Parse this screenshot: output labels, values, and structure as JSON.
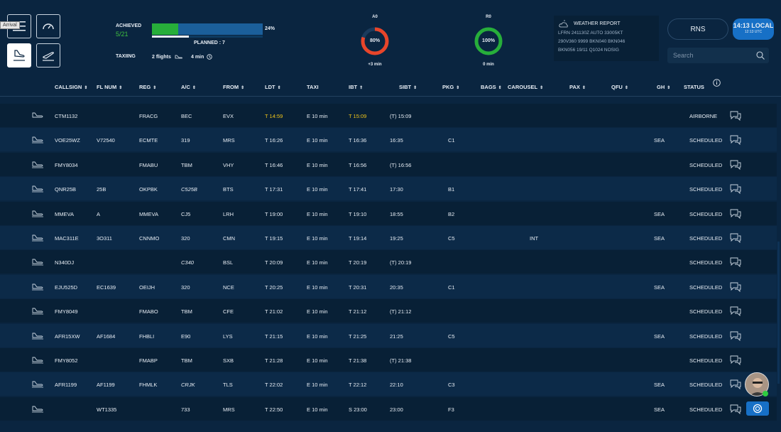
{
  "toolbar": {
    "arrival_tooltip": "Arrival"
  },
  "progress": {
    "achieved_label": "ACHIEVED",
    "achieved_value": "5/21",
    "achieved_fraction": 0.238,
    "planned_fraction": 0.333,
    "percent": "24%",
    "planned_label": "PLANNED : 7",
    "taxiing_label": "TAXIING",
    "taxiing_flights": "2 flights",
    "taxiing_time": "4 min"
  },
  "donuts": [
    {
      "title": "A0",
      "value": "80%",
      "sub": "+3 min",
      "color": "#e8452a",
      "fraction": 0.8
    },
    {
      "title": "R0",
      "value": "100%",
      "sub": "0 min",
      "color": "#27ae3a",
      "fraction": 1.0
    }
  ],
  "weather": {
    "title": "WEATHER REPORT",
    "lines": [
      "LFRN 241130Z AUTO 33005KT",
      "290V360 9999 BKN040 BKN046",
      "BKN056 19/11 Q1024 NOSIG"
    ]
  },
  "rns_label": "RNS",
  "clock": {
    "local": "14:13 LOCAL",
    "utc": "12:13 UTC"
  },
  "search": {
    "placeholder": "Search"
  },
  "columns": [
    "CALLSIGN",
    "FL NUM",
    "REG",
    "A/C",
    "FROM",
    "LDT",
    "TAXI",
    "IBT",
    "SIBT",
    "PKG",
    "BAGS",
    "CAROUSEL",
    "PAX",
    "QFU",
    "GH",
    "STATUS"
  ],
  "sort_markers": {
    "CALLSIGN": "⇕",
    "FL NUM": "⇕",
    "REG": "⇕",
    "A/C": "⇕",
    "FROM": "⇕",
    "LDT": "⇕",
    "IBT": "⇑",
    "SIBT": "⇕",
    "PKG": "⇕",
    "BAGS": "⇕",
    "CAROUSEL": "⇕",
    "PAX": "⇕",
    "QFU": "⇕",
    "GH": "⇕"
  },
  "flights": [
    {
      "callsign": "CTM1132",
      "flnum": "",
      "reg": "FRACG",
      "ac": "BEC",
      "ac_italic": false,
      "from": "EVX",
      "ldt": "T 14:59",
      "ldt_yellow": true,
      "taxi": "E 10 min",
      "ibt": "T 15:09",
      "ibt_yellow": true,
      "sibt": "(T) 15:09",
      "pkg": "",
      "bags": "",
      "carousel": "",
      "pax": "",
      "qfu": "",
      "gh": "",
      "status": "AIRBORNE",
      "taxiing": true
    },
    {
      "callsign": "VOE25WZ",
      "flnum": "V72540",
      "reg": "ECMTE",
      "ac": "319",
      "ac_italic": false,
      "from": "MRS",
      "ldt": "T 16:26",
      "ldt_yellow": false,
      "taxi": "E 10 min",
      "ibt": "T 16:36",
      "ibt_yellow": false,
      "sibt": "16:35",
      "pkg": "C1",
      "bags": "",
      "carousel": "",
      "pax": "",
      "qfu": "",
      "gh": "SEA",
      "status": "SCHEDULED",
      "taxiing": false
    },
    {
      "callsign": "FMY8034",
      "flnum": "",
      "reg": "FMABU",
      "ac": "TBM",
      "ac_italic": false,
      "from": "VHY",
      "ldt": "T 16:46",
      "ldt_yellow": false,
      "taxi": "E 10 min",
      "ibt": "T 16:56",
      "ibt_yellow": false,
      "sibt": "(T) 16:56",
      "pkg": "",
      "bags": "",
      "carousel": "",
      "pax": "",
      "qfu": "",
      "gh": "",
      "status": "SCHEDULED",
      "taxiing": false
    },
    {
      "callsign": "QNR25B",
      "flnum": "25B",
      "reg": "OKPBK",
      "ac": "C525B",
      "ac_italic": true,
      "from": "BTS",
      "ldt": "T 17:31",
      "ldt_yellow": false,
      "taxi": "E 10 min",
      "ibt": "T 17:41",
      "ibt_yellow": false,
      "sibt": "17:30",
      "pkg": "B1",
      "bags": "",
      "carousel": "",
      "pax": "",
      "qfu": "",
      "gh": "",
      "status": "SCHEDULED",
      "taxiing": false
    },
    {
      "callsign": "MMEVA",
      "flnum": "A",
      "reg": "MMEVA",
      "ac": "CJ5",
      "ac_italic": false,
      "from": "LRH",
      "ldt": "T 19:00",
      "ldt_yellow": false,
      "taxi": "E 10 min",
      "ibt": "T 19:10",
      "ibt_yellow": false,
      "sibt": "18:55",
      "pkg": "B2",
      "bags": "",
      "carousel": "",
      "pax": "",
      "qfu": "",
      "gh": "SEA",
      "status": "SCHEDULED",
      "taxiing": false
    },
    {
      "callsign": "MAC311E",
      "flnum": "3O311",
      "reg": "CNNMO",
      "ac": "320",
      "ac_italic": false,
      "from": "CMN",
      "ldt": "T 19:15",
      "ldt_yellow": false,
      "taxi": "E 10 min",
      "ibt": "T 19:14",
      "ibt_yellow": false,
      "sibt": "19:25",
      "pkg": "C5",
      "bags": "",
      "carousel": "INT",
      "pax": "",
      "qfu": "",
      "gh": "SEA",
      "status": "SCHEDULED",
      "taxiing": false
    },
    {
      "callsign": "N340DJ",
      "flnum": "",
      "reg": "",
      "ac": "C340",
      "ac_italic": true,
      "from": "BSL",
      "ldt": "T 20:09",
      "ldt_yellow": false,
      "taxi": "E 10 min",
      "ibt": "T 20:19",
      "ibt_yellow": false,
      "sibt": "(T) 20:19",
      "pkg": "",
      "bags": "",
      "carousel": "",
      "pax": "",
      "qfu": "",
      "gh": "",
      "status": "SCHEDULED",
      "taxiing": false
    },
    {
      "callsign": "EJU525D",
      "flnum": "EC1639",
      "reg": "OEIJH",
      "ac": "320",
      "ac_italic": false,
      "from": "NCE",
      "ldt": "T 20:25",
      "ldt_yellow": false,
      "taxi": "E 10 min",
      "ibt": "T 20:31",
      "ibt_yellow": false,
      "sibt": "20:35",
      "pkg": "C1",
      "bags": "",
      "carousel": "",
      "pax": "",
      "qfu": "",
      "gh": "SEA",
      "status": "SCHEDULED",
      "taxiing": false
    },
    {
      "callsign": "FMY8049",
      "flnum": "",
      "reg": "FMABO",
      "ac": "TBM",
      "ac_italic": false,
      "from": "CFE",
      "ldt": "T 21:02",
      "ldt_yellow": false,
      "taxi": "E 10 min",
      "ibt": "T 21:12",
      "ibt_yellow": false,
      "sibt": "(T) 21:12",
      "pkg": "",
      "bags": "",
      "carousel": "",
      "pax": "",
      "qfu": "",
      "gh": "",
      "status": "SCHEDULED",
      "taxiing": false
    },
    {
      "callsign": "AFR15XW",
      "flnum": "AF1684",
      "reg": "FHBLI",
      "ac": "E90",
      "ac_italic": false,
      "from": "LYS",
      "ldt": "T 21:15",
      "ldt_yellow": false,
      "taxi": "E 10 min",
      "ibt": "T 21:25",
      "ibt_yellow": false,
      "sibt": "21:25",
      "pkg": "C5",
      "bags": "",
      "carousel": "",
      "pax": "",
      "qfu": "",
      "gh": "SEA",
      "status": "SCHEDULED",
      "taxiing": false
    },
    {
      "callsign": "FMY8052",
      "flnum": "",
      "reg": "FMABP",
      "ac": "TBM",
      "ac_italic": false,
      "from": "SXB",
      "ldt": "T 21:28",
      "ldt_yellow": false,
      "taxi": "E 10 min",
      "ibt": "T 21:38",
      "ibt_yellow": false,
      "sibt": "(T) 21:38",
      "pkg": "",
      "bags": "",
      "carousel": "",
      "pax": "",
      "qfu": "",
      "gh": "",
      "status": "SCHEDULED",
      "taxiing": false
    },
    {
      "callsign": "AFR1199",
      "flnum": "AF1199",
      "reg": "FHMLK",
      "ac": "CRJK",
      "ac_italic": true,
      "from": "TLS",
      "ldt": "T 22:02",
      "ldt_yellow": false,
      "taxi": "E 10 min",
      "ibt": "T 22:12",
      "ibt_yellow": false,
      "sibt": "22:10",
      "pkg": "C3",
      "bags": "",
      "carousel": "",
      "pax": "",
      "qfu": "",
      "gh": "SEA",
      "status": "SCHEDULED",
      "taxiing": false
    },
    {
      "callsign": "",
      "flnum": "WT1335",
      "reg": "",
      "ac": "733",
      "ac_italic": false,
      "from": "MRS",
      "ldt": "T 22:50",
      "ldt_yellow": false,
      "taxi": "E 10 min",
      "ibt": "S 23:00",
      "ibt_yellow": false,
      "sibt": "23:00",
      "pkg": "F3",
      "bags": "",
      "carousel": "",
      "pax": "",
      "qfu": "",
      "gh": "SEA",
      "status": "SCHEDULED",
      "taxiing": false
    }
  ]
}
